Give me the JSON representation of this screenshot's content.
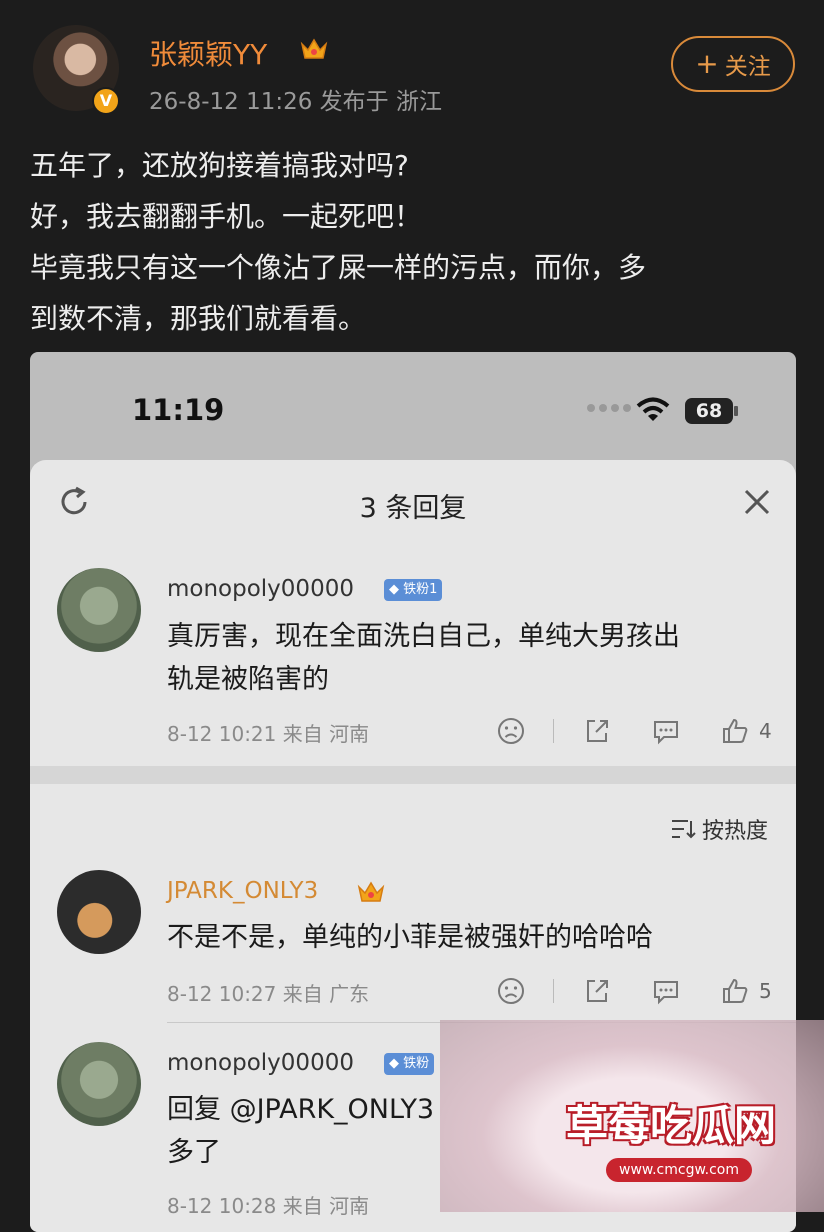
{
  "post": {
    "author": "张颖颖YY",
    "meta": "26-8-12 11:26  发布于 浙江",
    "follow_label": "关注",
    "lines": [
      "五年了，还放狗接着搞我对吗?",
      "好，我去翻翻手机。一起死吧！",
      "毕竟我只有这一个像沾了屎一样的污点，而你，多",
      "到数不清，那我们就看看。"
    ]
  },
  "screenshot": {
    "status_time": "11:19",
    "battery": "68",
    "sheet_title": "3 条回复",
    "sort_label": "按热度",
    "comments": [
      {
        "user": "monopoly00000",
        "badge": "铁粉1",
        "lines": [
          "真厉害，现在全面洗白自己，单纯大男孩出",
          "轨是被陷害的"
        ],
        "meta": "8-12 10:21  来自 河南",
        "likes": "4"
      },
      {
        "user": "JPARK_ONLY3",
        "lines": [
          "不是不是，单纯的小菲是被强奸的哈哈哈"
        ],
        "meta": "8-12 10:27  来自 广东",
        "likes": "5"
      },
      {
        "user": "monopoly00000",
        "badge": "铁粉",
        "lines": [
          "回复 @JPARK_ONLY3",
          "多了"
        ],
        "meta": "8-12 10:28  来自 河南"
      }
    ]
  },
  "watermark": {
    "title": "草莓吃瓜网",
    "url": "www.cmcgw.com"
  },
  "colors": {
    "accent_orange": "#f08b3a",
    "badge_blue": "#5b8ed6",
    "page_bg": "#1c1c1c"
  }
}
